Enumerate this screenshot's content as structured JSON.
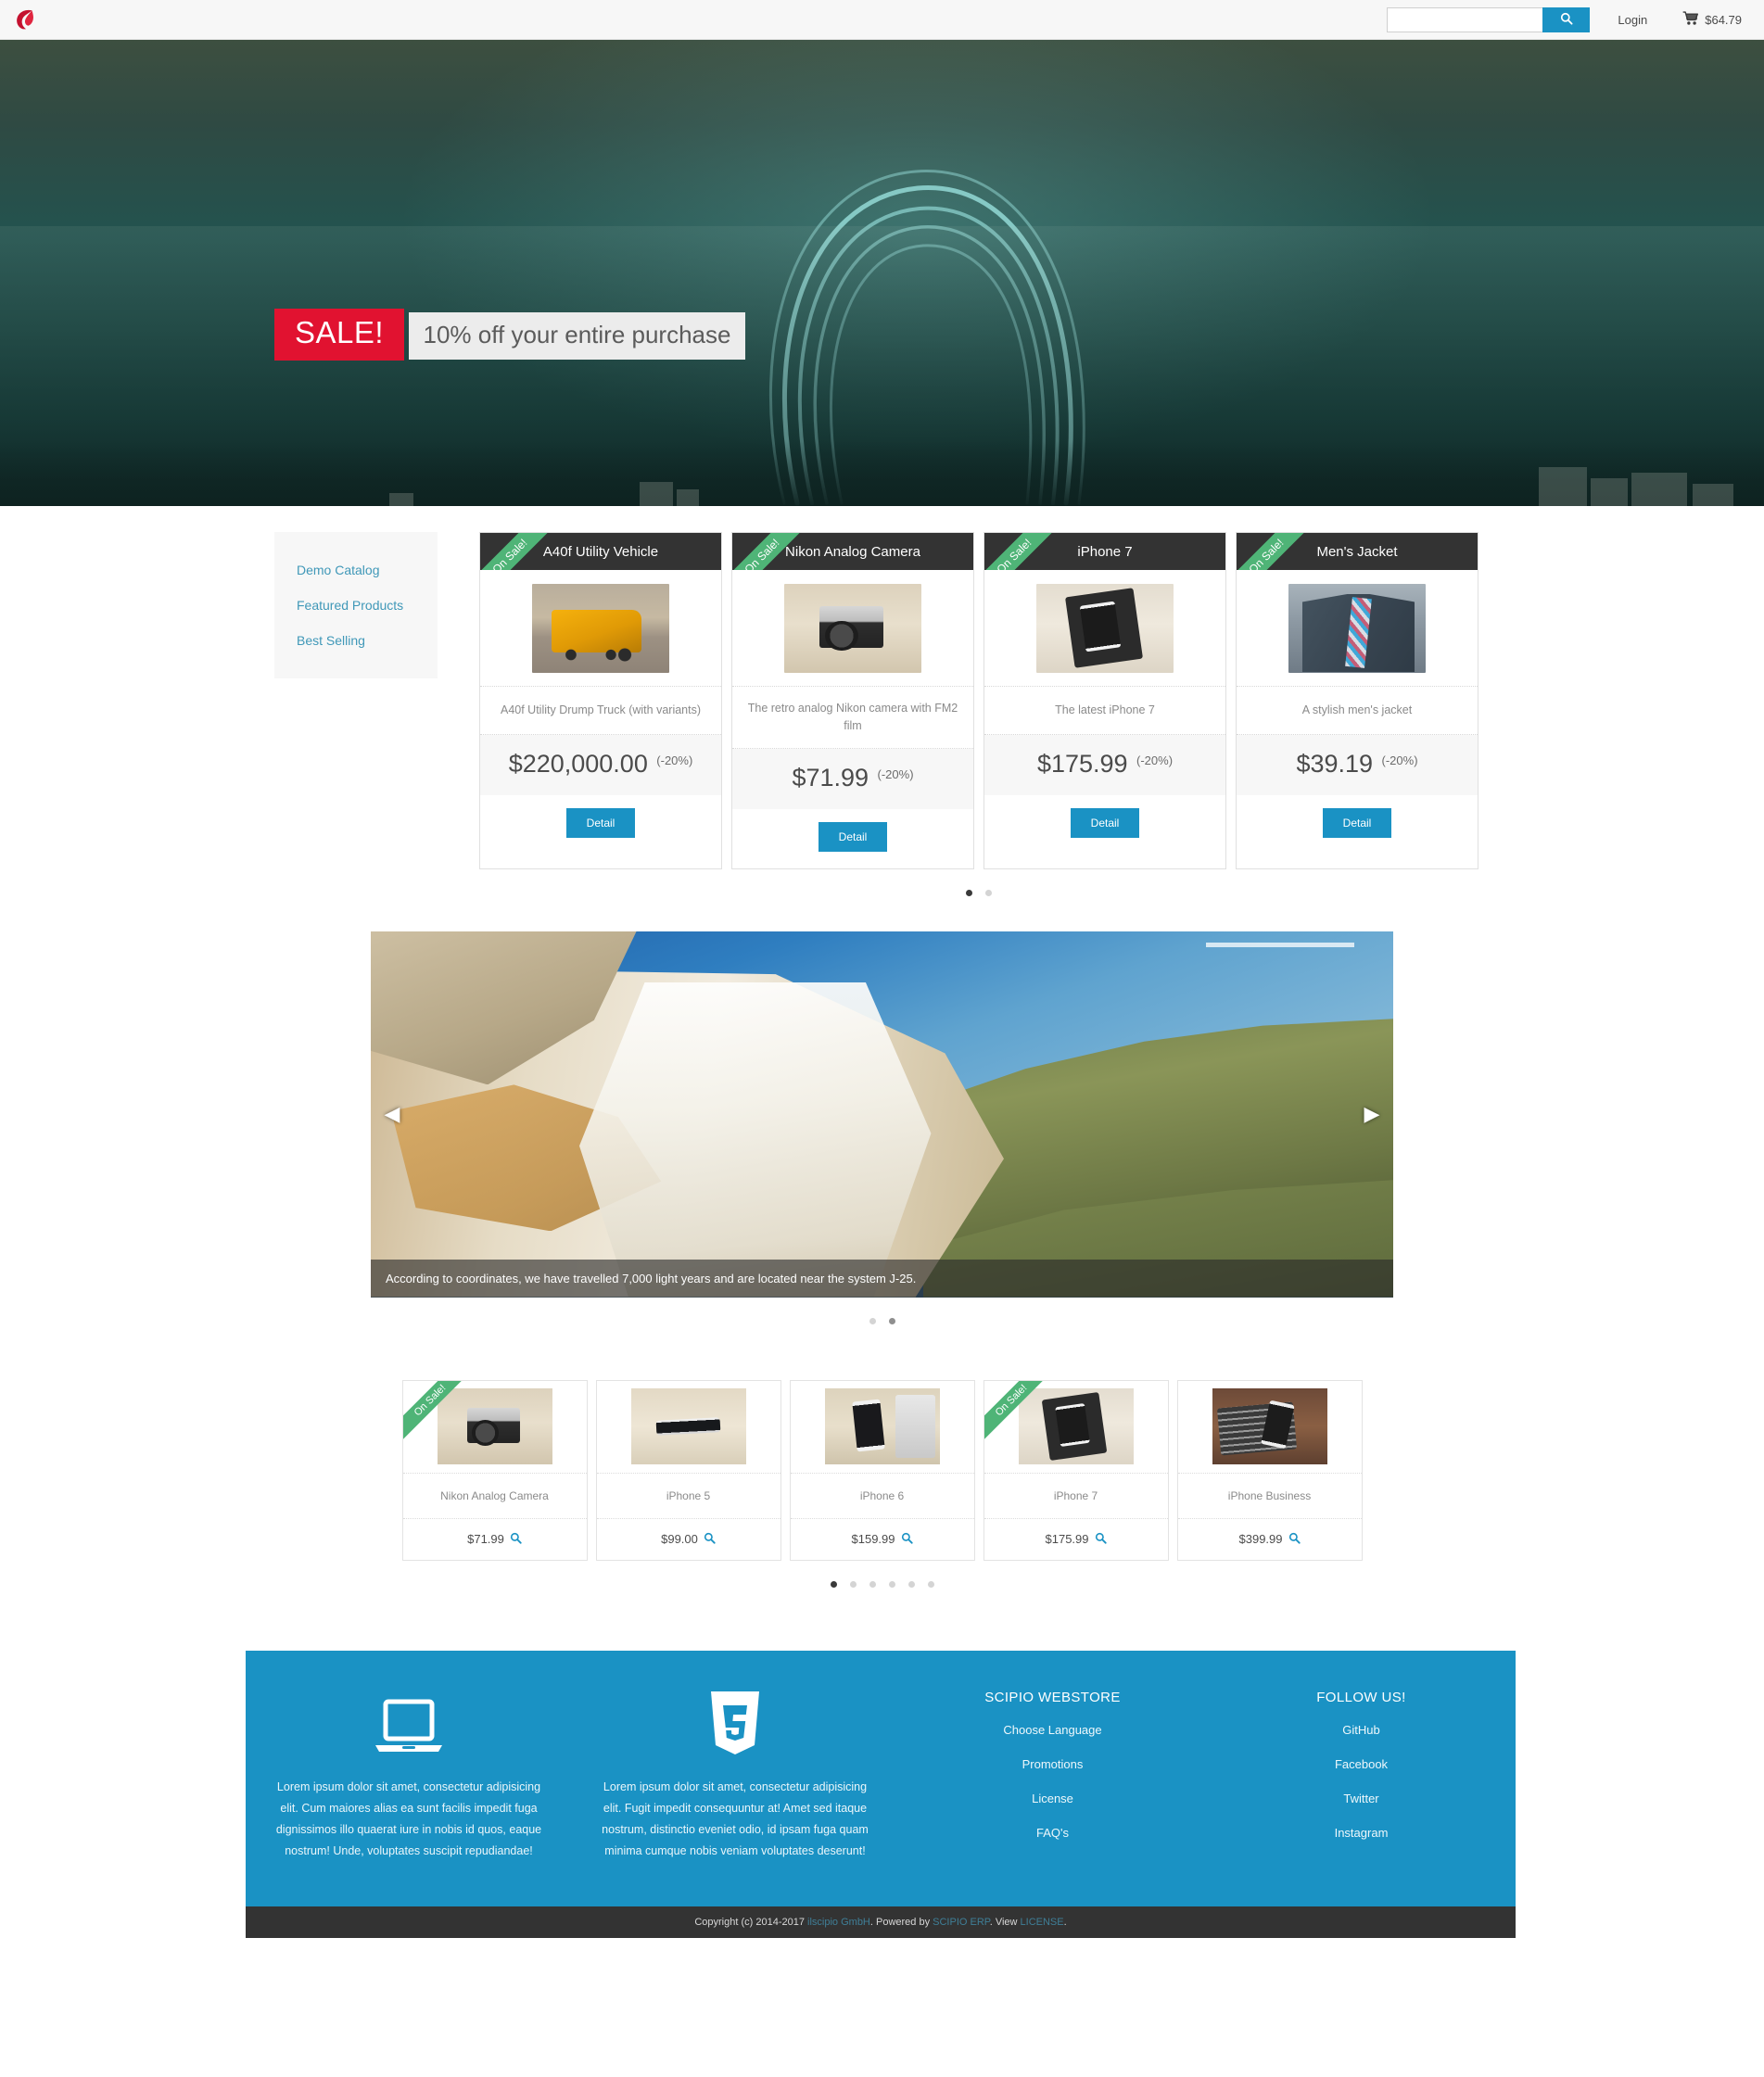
{
  "header": {
    "logo_icon": "scipio-teardrop-logo",
    "search_placeholder": "",
    "search_value": "",
    "search_icon": "search-icon",
    "login_label": "Login",
    "cart_icon": "shopping-cart-icon",
    "cart_total": "$64.79",
    "accent_color": "#1a92c4"
  },
  "hero": {
    "badge": "SALE!",
    "subtitle": "10% off your entire purchase",
    "badge_color": "#e11230"
  },
  "sidebar": {
    "items": [
      {
        "label": "Demo Catalog"
      },
      {
        "label": "Featured Products"
      },
      {
        "label": "Best Selling"
      }
    ]
  },
  "featured": {
    "ribbon_label": "On Sale!",
    "ribbon_color": "#4fb477",
    "detail_label": "Detail",
    "products": [
      {
        "title": "A40f Utility Vehicle",
        "description": "A40f Utility Drump Truck (with variants)",
        "price": "$220,000.00",
        "discount": "(-20%)",
        "on_sale": true,
        "image": "img-truck"
      },
      {
        "title": "Nikon Analog Camera",
        "description": "The retro analog Nikon camera with FM2 film",
        "price": "$71.99",
        "discount": "(-20%)",
        "on_sale": true,
        "image": "img-camera"
      },
      {
        "title": "iPhone 7",
        "description": "The latest iPhone 7",
        "price": "$175.99",
        "discount": "(-20%)",
        "on_sale": true,
        "image": "img-iphone7"
      },
      {
        "title": "Men's Jacket",
        "description": "A stylish men's jacket",
        "price": "$39.19",
        "discount": "(-20%)",
        "on_sale": true,
        "image": "img-jacket"
      }
    ],
    "pager": [
      {
        "state": "active"
      },
      {
        "state": "inactive"
      }
    ]
  },
  "carousel": {
    "caption": "According to coordinates, we have travelled 7,000 light years and are located near the system J-25.",
    "prev_icon": "chevron-left-icon",
    "next_icon": "chevron-right-icon",
    "pager": [
      {
        "state": "inactive"
      },
      {
        "state": "active"
      }
    ]
  },
  "mini_products": {
    "ribbon_label": "On Sale!",
    "zoom_icon": "magnifier-icon",
    "items": [
      {
        "name": "Nikon Analog Camera",
        "price": "$71.99",
        "on_sale": true,
        "image": "img-camera"
      },
      {
        "name": "iPhone 5",
        "price": "$99.00",
        "on_sale": false,
        "image": "img-iphone5"
      },
      {
        "name": "iPhone 6",
        "price": "$159.99",
        "on_sale": false,
        "image": "img-iphone6"
      },
      {
        "name": "iPhone 7",
        "price": "$175.99",
        "on_sale": true,
        "image": "img-iphone7"
      },
      {
        "name": "iPhone Business",
        "price": "$399.99",
        "on_sale": false,
        "image": "img-business"
      }
    ],
    "pager": [
      {
        "state": "active"
      },
      {
        "state": "inactive"
      },
      {
        "state": "inactive"
      },
      {
        "state": "inactive"
      },
      {
        "state": "inactive"
      },
      {
        "state": "inactive"
      }
    ]
  },
  "footer": {
    "background_color": "#1a92c4",
    "columns": [
      {
        "icon": "laptop-icon",
        "text": "Lorem ipsum dolor sit amet, consectetur adipisicing elit. Cum maiores alias ea sunt facilis impedit fuga dignissimos illo quaerat iure in nobis id quos, eaque nostrum! Unde, voluptates suscipit repudiandae!"
      },
      {
        "icon": "html5-shield-icon",
        "text": "Lorem ipsum dolor sit amet, consectetur adipisicing elit. Fugit impedit consequuntur at! Amet sed itaque nostrum, distinctio eveniet odio, id ipsam fuga quam minima cumque nobis veniam voluptates deserunt!"
      }
    ],
    "store_links": {
      "title": "SCIPIO WEBSTORE",
      "items": [
        {
          "label": "Choose Language"
        },
        {
          "label": "Promotions"
        },
        {
          "label": "License"
        },
        {
          "label": "FAQ's"
        }
      ]
    },
    "social_links": {
      "title": "FOLLOW US!",
      "items": [
        {
          "label": "GitHub"
        },
        {
          "label": "Facebook"
        },
        {
          "label": "Twitter"
        },
        {
          "label": "Instagram"
        }
      ]
    }
  },
  "copyright": {
    "prefix": "Copyright (c) 2014-2017 ",
    "company": "ilscipio GmbH",
    "middle": ". Powered by ",
    "platform": "SCIPIO ERP",
    "view": ". View ",
    "license": "LICENSE",
    "suffix": "."
  }
}
